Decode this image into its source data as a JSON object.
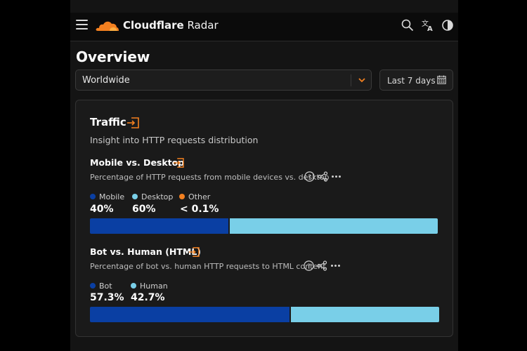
{
  "header": {
    "brand_bold": "Cloudflare",
    "brand_rest": " Radar"
  },
  "page_title": "Overview",
  "location_select": {
    "value": "Worldwide"
  },
  "date_range": {
    "value": "Last 7 days"
  },
  "traffic": {
    "title": "Traffic",
    "subtitle": "Insight into HTTP requests distribution",
    "mobile_desktop": {
      "title": "Mobile vs. Desktop",
      "description": "Percentage of HTTP requests from mobile devices vs. desktop",
      "items": [
        {
          "label": "Mobile",
          "value": "40%",
          "share": 0.4,
          "color": "#0a3fa3"
        },
        {
          "label": "Desktop",
          "value": "60%",
          "share": 0.6,
          "color": "#79cfe8"
        },
        {
          "label": "Other",
          "value": "< 0.1%",
          "share": 0.0,
          "color": "#f38020"
        }
      ]
    },
    "bot_human": {
      "title": "Bot vs. Human (HTML)",
      "description": "Percentage of bot vs. human HTTP requests to HTML content",
      "items": [
        {
          "label": "Bot",
          "value": "57.3%",
          "share": 0.573,
          "color": "#0a3fa3"
        },
        {
          "label": "Human",
          "value": "42.7%",
          "share": 0.427,
          "color": "#79cfe8"
        }
      ]
    }
  },
  "colors": {
    "accent": "#f38020",
    "series_dark": "#0a3fa3",
    "series_light": "#79cfe8"
  },
  "icons": [
    "menu-icon",
    "cloudflare-logo",
    "search-icon",
    "translate-icon",
    "theme-toggle-icon",
    "chevron-down-icon",
    "calendar-icon",
    "expand-icon",
    "help-icon",
    "share-icon",
    "more-icon"
  ]
}
